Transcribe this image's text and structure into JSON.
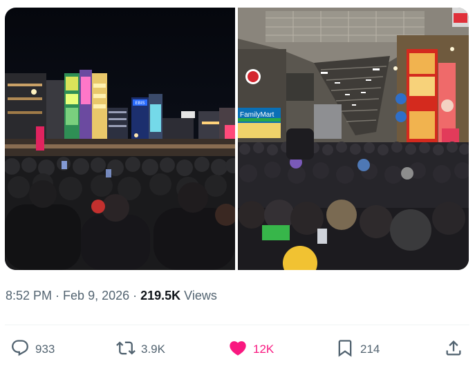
{
  "tweet": {
    "time": "8:52 PM",
    "date": "Feb 9, 2026",
    "separator": "·",
    "views_count": "219.5K",
    "views_label": "Views"
  },
  "images": [
    {
      "name": "night-street-crowd-photo",
      "signs": [
        "EBIS"
      ]
    },
    {
      "name": "shopping-arcade-crowd-photo",
      "signs": [
        "FamilyMart"
      ]
    }
  ],
  "actions": {
    "reply": {
      "icon": "reply-icon",
      "count": "933"
    },
    "repost": {
      "icon": "repost-icon",
      "count": "3.9K"
    },
    "like": {
      "icon": "heart-icon",
      "count": "12K",
      "liked": true,
      "color": "#f91880"
    },
    "bookmark": {
      "icon": "bookmark-icon",
      "count": "214"
    },
    "share": {
      "icon": "share-icon"
    }
  },
  "colors": {
    "text": "#0f1419",
    "muted": "#536471",
    "like": "#f91880",
    "divider": "#eff3f4"
  }
}
